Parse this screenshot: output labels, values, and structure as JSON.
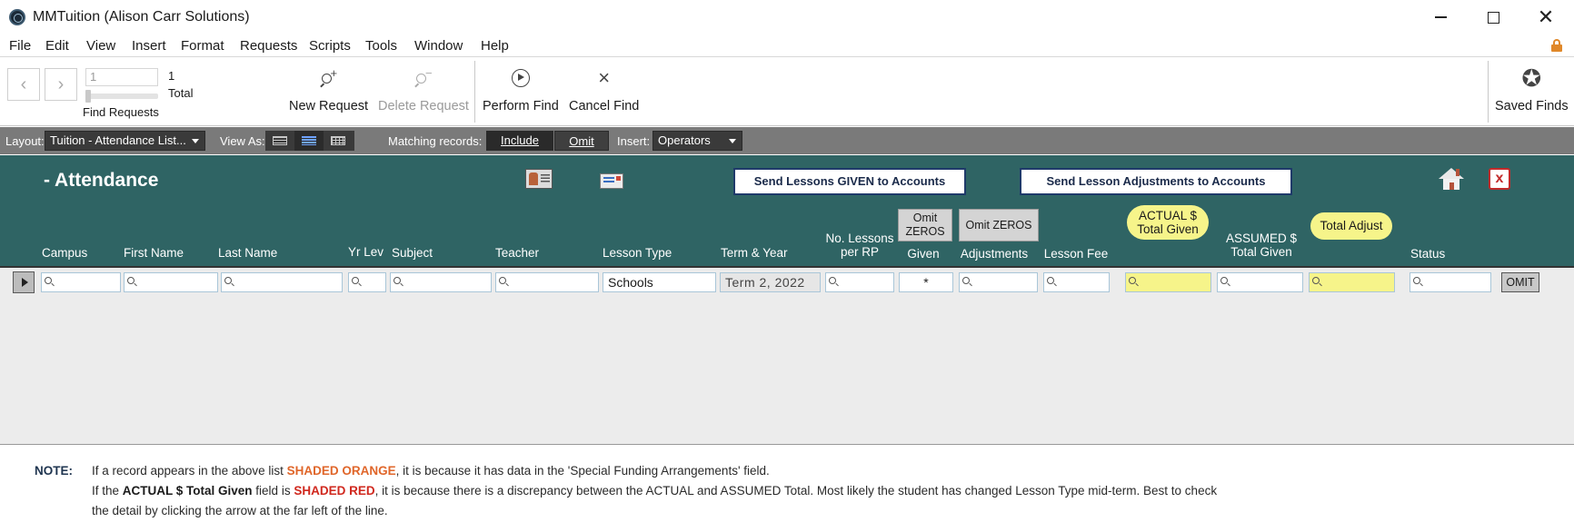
{
  "window": {
    "title": "MMTuition (Alison Carr Solutions)",
    "minimize_glyph": "—",
    "close_glyph": "✕"
  },
  "menu": [
    "File",
    "Edit",
    "View",
    "Insert",
    "Format",
    "Requests",
    "Scripts",
    "Tools",
    "Window",
    "Help"
  ],
  "toolbar": {
    "back_glyph": "‹",
    "forward_glyph": "›",
    "record_input_value": "1",
    "record_count": "1",
    "record_total_label": "Total",
    "find_requests_label": "Find Requests",
    "new_request": "New Request",
    "delete_request": "Delete Request",
    "perform_find": "Perform Find",
    "cancel_find": "Cancel Find",
    "cancel_glyph": "×",
    "saved_finds": "Saved Finds",
    "plus_sign": "+",
    "minus_sign": "−",
    "star_glyph": "✪"
  },
  "layout_bar": {
    "layout_label": "Layout:",
    "layout_value": "Tuition - Attendance List...",
    "view_as_label": "View As:",
    "matching_label": "Matching records:",
    "include": "Include",
    "omit": "Omit",
    "insert_label": "Insert:",
    "insert_value": "Operators"
  },
  "header": {
    "title": "- Attendance",
    "send_given": "Send Lessons GIVEN to Accounts",
    "send_adjustments": "Send Lesson Adjustments to Accounts",
    "close_label": "x",
    "omit_zeros_1": [
      "Omit",
      "ZEROS"
    ],
    "omit_zeros_2": "Omit ZEROS"
  },
  "columns": {
    "campus": "Campus",
    "first_name": "First Name",
    "last_name": "Last Name",
    "yr_lev": "Yr Lev",
    "subject": "Subject",
    "teacher": "Teacher",
    "lesson_type": "Lesson Type",
    "term_year": "Term & Year",
    "no_lessons": [
      "No. Lessons",
      "per RP"
    ],
    "given": "Given",
    "adjustments": "Adjustments",
    "lesson_fee": "Lesson Fee",
    "actual_total": [
      "ACTUAL $",
      "Total Given"
    ],
    "assumed_total": [
      "ASSUMED $",
      "Total Given"
    ],
    "total_adjust": "Total Adjust",
    "status": "Status"
  },
  "find_row": {
    "lesson_type": "Schools",
    "term_year": "Term 2, 2022",
    "given": "*",
    "omit_button": "OMIT"
  },
  "note": {
    "label": "NOTE:",
    "line1_a": "If a record appears in the above list ",
    "line1_b": "SHADED ORANGE",
    "line1_c": ", it is because it has data in the 'Special Funding Arrangements' field.",
    "line2_a": "If the ",
    "line2_b": "ACTUAL $ Total Given",
    "line2_c": " field is ",
    "line2_d": "SHADED RED",
    "line2_e": ", it is because there is a discrepancy between the ACTUAL and ASSUMED Total.  Most likely the student has changed Lesson Type mid-term.  Best to check",
    "line3": "the detail by clicking the arrow at the far left of the line."
  },
  "colors": {
    "header_teal": "#2f6464",
    "highlight_yellow": "#f6f48a",
    "note_orange": "#e0662a",
    "note_red": "#d0281e"
  }
}
